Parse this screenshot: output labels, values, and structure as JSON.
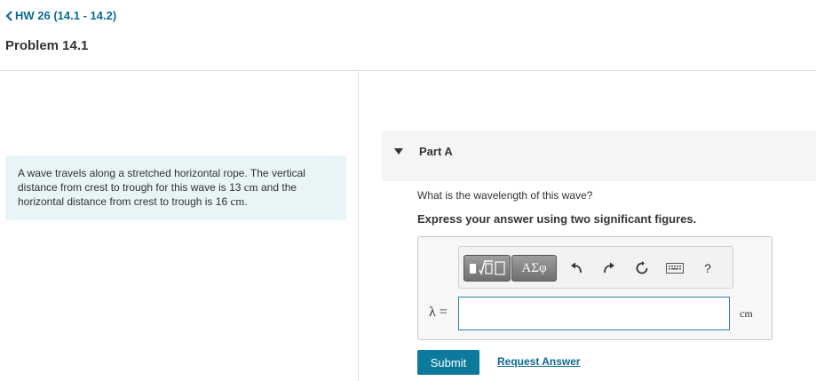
{
  "nav": {
    "back_label": "HW 26 (14.1 - 14.2)"
  },
  "problem": {
    "title": "Problem 14.1",
    "text_part1": "A wave travels along a stretched horizontal rope. The vertical distance from crest to trough for this wave is 13 ",
    "unit1": "cm",
    "text_part2": " and the horizontal distance from crest to trough is 16 ",
    "unit2": "cm",
    "text_part3": "."
  },
  "part": {
    "label": "Part A",
    "question": "What is the wavelength of this wave?",
    "instruction": "Express your answer using two significant figures."
  },
  "toolbar": {
    "greek_label": "ΑΣφ",
    "help_label": "?",
    "icons": [
      "templates-icon",
      "undo-icon",
      "redo-icon",
      "reset-icon",
      "keyboard-icon",
      "help-icon"
    ]
  },
  "answer": {
    "variable_label": "λ =",
    "value": "",
    "unit": "cm"
  },
  "actions": {
    "submit_label": "Submit",
    "request_label": "Request Answer"
  },
  "colors": {
    "accent": "#0b7a9c",
    "link": "#0b6a92",
    "problem_bg": "#e8f4f6"
  }
}
